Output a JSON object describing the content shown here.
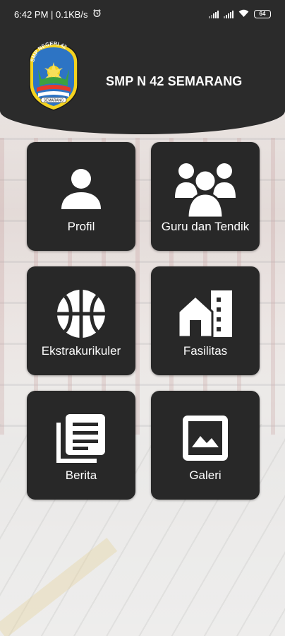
{
  "status_bar": {
    "time_speed": "6:42 PM | 0.1KB/s",
    "battery": "64"
  },
  "header": {
    "title": "SMP N 42 SEMARANG",
    "logo": {
      "top_text": "SMP NEGERI 42",
      "bottom_text": "SEMARANG"
    }
  },
  "menu": [
    {
      "label": "Profil",
      "icon": "person-icon"
    },
    {
      "label": "Guru dan Tendik",
      "icon": "group-icon"
    },
    {
      "label": "Ekstrakurikuler",
      "icon": "basketball-icon"
    },
    {
      "label": "Fasilitas",
      "icon": "building-icon"
    },
    {
      "label": "Berita",
      "icon": "news-icon"
    },
    {
      "label": "Galeri",
      "icon": "image-icon"
    }
  ],
  "colors": {
    "header": "#2b2b2b",
    "tile": "#282828",
    "text": "#ffffff"
  }
}
